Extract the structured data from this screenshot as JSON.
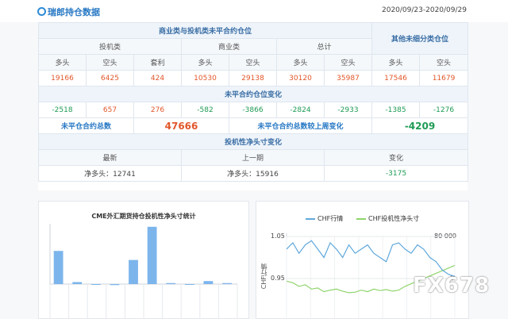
{
  "header": {
    "title": "瑞郎持仓数据",
    "date_range": "2020/09/23-2020/09/29"
  },
  "table": {
    "section1_title": "商业类与投机类未平合约仓位",
    "other_title": "其他未细分类仓位",
    "groups": {
      "spec": "投机类",
      "comm": "商业类",
      "total": "总计"
    },
    "cols": {
      "long": "多头",
      "short": "空头",
      "spread": "套利"
    },
    "row1": [
      "19166",
      "6425",
      "424",
      "10530",
      "29138",
      "30120",
      "35987",
      "17546",
      "11679"
    ],
    "section2_title": "未平合约仓位变化",
    "row2": [
      "-2518",
      "657",
      "276",
      "-582",
      "-3866",
      "-2824",
      "-2933",
      "-1385",
      "-1276"
    ],
    "oi_total_label": "未平仓合约总数",
    "oi_total_value": "47666",
    "oi_change_label": "未平仓合约总数较上周变化",
    "oi_change_value": "-4209",
    "section3_title": "投机性净头寸变化",
    "net_cols": {
      "latest": "最新",
      "prev": "上一期",
      "change": "变化"
    },
    "net_values": {
      "latest": "净多头：12741",
      "prev": "净多头：15916",
      "change": "-3175"
    }
  },
  "chart_data": [
    {
      "type": "bar",
      "title": "CME外汇期货持仓投机性净头寸统计",
      "values": [
        33,
        2,
        0,
        -1,
        24,
        57,
        1,
        0,
        3,
        1
      ],
      "colors": {
        "bar": "#7cb5ec"
      }
    },
    {
      "type": "line",
      "legend": [
        "CHF行情",
        "CHF投机性净头寸"
      ],
      "left_ticks": [
        "1.05",
        "0.95"
      ],
      "right_ticks": [
        "80 000",
        "0"
      ],
      "ylabel": "CHF行情",
      "series": [
        {
          "name": "CHF行情",
          "values": [
            1.02,
            1.035,
            1.01,
            1.03,
            1.04,
            1.02,
            1.0,
            1.035,
            1.02,
            1.0,
            1.03,
            1.01,
            1.02,
            1.03,
            1.01,
            1.0,
            0.99,
            1.03,
            1.035,
            1.02,
            1.01,
            1.03,
            1.02,
            1.0,
            0.99,
            0.97,
            0.96,
            0.955
          ]
        },
        {
          "name": "CHF投机性净头寸",
          "values": [
            -5000,
            -8000,
            -15000,
            -12000,
            -20000,
            -18000,
            -25000,
            -22000,
            -20000,
            -24000,
            -27000,
            -26000,
            -22000,
            -25000,
            -20000,
            -23000,
            -21000,
            -24000,
            -22000,
            -15000,
            -10000,
            -5000,
            0,
            5000,
            10000,
            15000,
            20000,
            25000
          ]
        }
      ],
      "colors": {
        "s1": "#5fa8dc",
        "s2": "#90d46c"
      }
    }
  ],
  "watermark": "FX678"
}
